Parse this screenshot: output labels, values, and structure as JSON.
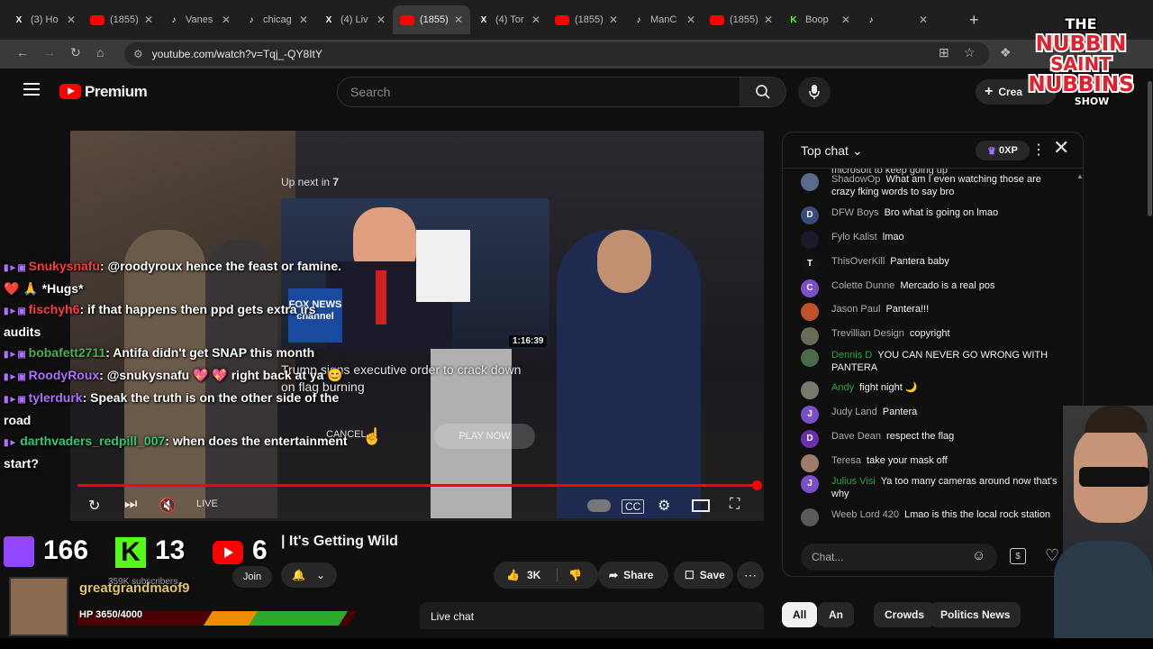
{
  "browser": {
    "tabs": [
      {
        "icon": "x-icon",
        "title": "(3) Ho",
        "color": "#ffffff"
      },
      {
        "icon": "youtube-icon",
        "title": "(1855)",
        "color": "#ff0000"
      },
      {
        "icon": "tiktok-icon",
        "title": "Vanes",
        "color": "#ffffff"
      },
      {
        "icon": "tiktok-icon",
        "title": "chicag",
        "color": "#ffffff"
      },
      {
        "icon": "x-icon",
        "title": "(4) Liv",
        "color": "#ffffff"
      },
      {
        "icon": "youtube-icon",
        "title": "(1855)",
        "color": "#ff0000",
        "active": true
      },
      {
        "icon": "x-icon",
        "title": "(4) Tor",
        "color": "#ffffff"
      },
      {
        "icon": "youtube-icon",
        "title": "(1855)",
        "color": "#ff0000"
      },
      {
        "icon": "tiktok-icon",
        "title": "ManC",
        "color": "#ffffff"
      },
      {
        "icon": "youtube-icon",
        "title": "(1855)",
        "color": "#ff0000"
      },
      {
        "icon": "kick-icon",
        "title": "Boop",
        "color": "#53fc18"
      },
      {
        "icon": "tiktok-icon",
        "title": "",
        "color": "#ffffff"
      }
    ],
    "url": "youtube.com/watch?v=Tqj_-QY8ItY"
  },
  "youtube": {
    "brand": "Premium",
    "search_placeholder": "Search",
    "create_label": "Crea"
  },
  "overlay_logo": {
    "line1": "THE",
    "line2": "NUBBIN",
    "line3": "SAINT",
    "line4": "NUBBINS",
    "line5": "SHOW"
  },
  "player": {
    "upnext_prefix": "Up next in ",
    "upnext_count": "7",
    "duration": "1:16:39",
    "next_title": "Trump signs executive order to crack down on flag burning",
    "cancel_label": "CANCEL",
    "playnow_label": "PLAY NOW",
    "live_label": "LIVE",
    "progress_fraction": 0.99,
    "thumb_badge": "FOX NEWS channel"
  },
  "stream_chat": [
    {
      "name": "Snukysnafu",
      "name_color": "#ff3b3b",
      "text": ": @roodyroux hence the feast or famine. ❤️ 🙏 *Hugs*"
    },
    {
      "name": "fischyh6",
      "name_color": "#ff3b3b",
      "text": ": if that happens then ppd gets extra irs audits"
    },
    {
      "name": "bobafett2711",
      "name_color": "#4caf50",
      "text": ": Antifa didn't get SNAP this month"
    },
    {
      "name": "RoodyRoux",
      "name_color": "#b070ff",
      "text": ": @snukysnafu 💖 💖 right back at ya 😊"
    },
    {
      "name": "tylerdurk",
      "name_color": "#b070ff",
      "text": ": Speak the truth is on the other side of the road"
    },
    {
      "name": "darthvaders_redpill_007",
      "name_color": "#2ecc71",
      "text": ": when does the entertainment start?"
    }
  ],
  "video_info": {
    "title_tail": "| It's Getting Wild",
    "subscribers": "359K subscribers",
    "join_label": "Join",
    "like_count": "3K",
    "share_label": "Share",
    "save_label": "Save",
    "livechat_label": "Live chat"
  },
  "stream_counters": {
    "twitch": "166",
    "kick": "13",
    "youtube": "6"
  },
  "stream_follower": {
    "name": "greatgrandmaof9",
    "hp": "HP 3650/4000"
  },
  "live_chat": {
    "header": "Top chat",
    "xp": "0XP",
    "partial": "microsoft to keep going up",
    "messages": [
      {
        "author": "ShadowOp",
        "text": "What am I even watching those are crazy fking words to say bro",
        "avatar_color": "#5a6a8a",
        "initial": "",
        "member": false
      },
      {
        "author": "DFW Boys",
        "text": "Bro what is going on lmao",
        "avatar_color": "#3a4a7a",
        "initial": "D",
        "member": false
      },
      {
        "author": "Fylo Kalist",
        "text": "lmao",
        "avatar_color": "#1a1a2a",
        "initial": "",
        "member": false
      },
      {
        "author": "ThisOverKill",
        "text": "Pantera baby",
        "avatar_color": "#111111",
        "initial": "T",
        "member": false
      },
      {
        "author": "Colette Dunne",
        "text": "Mercado is a real pos",
        "avatar_color": "#7b4fc9",
        "initial": "C",
        "member": false
      },
      {
        "author": "Jason Paul",
        "text": "Pantera!!!",
        "avatar_color": "#c0522a",
        "initial": "",
        "member": false
      },
      {
        "author": "Trevillian Design",
        "text": "copyright",
        "avatar_color": "#6a6a5a",
        "initial": "",
        "member": false
      },
      {
        "author": "Dennis D",
        "text": "YOU CAN NEVER GO WRONG WITH PANTERA",
        "avatar_color": "#4a6a4a",
        "initial": "",
        "member": true
      },
      {
        "author": "Andy",
        "text": "fight night 🌙",
        "avatar_color": "#7a7a6a",
        "initial": "",
        "member": true
      },
      {
        "author": "Judy Land",
        "text": "Pantera",
        "avatar_color": "#7b4fc9",
        "initial": "J",
        "member": false
      },
      {
        "author": "Dave Dean",
        "text": "respect the flag",
        "avatar_color": "#6a2fb0",
        "initial": "D",
        "member": false
      },
      {
        "author": "Teresa",
        "text": "take your mask off",
        "avatar_color": "#a07a6a",
        "initial": "",
        "member": false
      },
      {
        "author": "Julius Visi",
        "text": "Ya too many cameras around now that's why",
        "avatar_color": "#7b4fc9",
        "initial": "J",
        "member": true
      },
      {
        "author": "Weeb Lord 420",
        "text": "Lmao is this the local rock station",
        "avatar_color": "#5a5a5a",
        "initial": "",
        "member": false
      }
    ],
    "input_placeholder": "Chat..."
  },
  "chips": [
    "All",
    "An",
    "Crowds",
    "Politics News"
  ]
}
